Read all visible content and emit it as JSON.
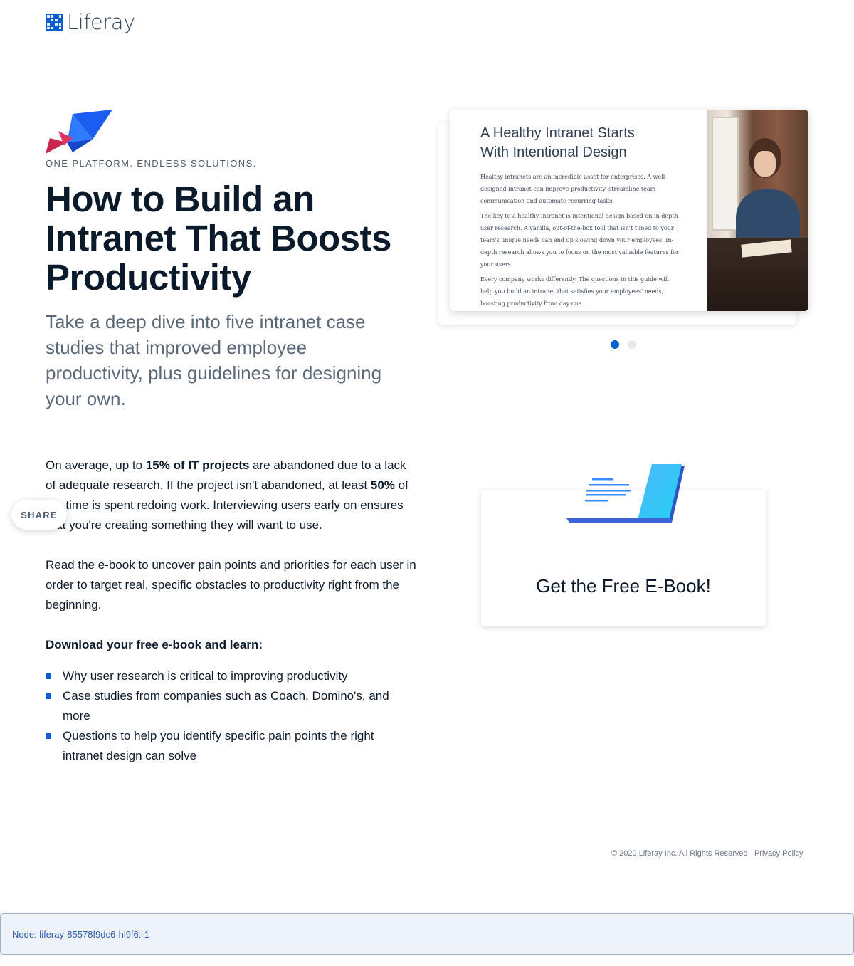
{
  "header": {
    "logo_text": "Liferay"
  },
  "hero": {
    "eyebrow": "ONE PLATFORM. ENDLESS SOLUTIONS.",
    "title": "How to Build an Intranet That Boosts Productivity",
    "subtitle": "Take a deep dive into five intranet case studies that improved employee productivity, plus guidelines for designing your own."
  },
  "preview": {
    "title_line1": "A Healthy Intranet Starts",
    "title_line2": "With Intentional Design",
    "para1": "Healthy intranets are an incredible asset for enterprises. A well-designed intranet can improve productivity, streamline team communication and automate recurring tasks.",
    "para2": "The key to a healthy intranet is intentional design based on in-depth user research. A vanilla, out-of-the-box tool that isn't tuned to your team's unique needs can end up slowing down your employees. In-depth research allows you to focus on the most valuable features for your users.",
    "para3": "Every company works differently. The questions in this guide will help you build an intranet that satisfies your employees' needs, boosting productivity from day one.",
    "active_slide": 1,
    "slide_count": 2
  },
  "body": {
    "p1_a": "On average, up to ",
    "p1_b": "15% of IT projects",
    "p1_c": " are abandoned due to a lack of adequate research. If the project isn't abandoned, at least ",
    "p1_d": "50%",
    "p1_e": " of the time is spent redoing work. Interviewing users early on ensures that you're creating something they will want to use.",
    "p2": "Read the e-book to uncover pain points and priorities for each user in order to target real, specific obstacles to productivity right from the beginning.",
    "learn_heading": "Download your free e-book and learn:",
    "bullets": [
      "Why user research is critical to improving productivity",
      "Case studies from companies such as Coach, Domino's, and more",
      "Questions to help you identify specific pain points the right intranet design can solve"
    ]
  },
  "share": {
    "label": "SHARE"
  },
  "cta": {
    "label": "Get the Free E-Book!"
  },
  "footer": {
    "copyright": "© 2020 Liferay Inc. All Rights Reserved",
    "privacy": "Privacy Policy"
  },
  "node_bar": {
    "text": "Node: liferay-85578f9dc6-hl9f6:-1"
  },
  "colors": {
    "accent": "#0b5fcc",
    "text": "#0b1a2b",
    "muted": "#5b6878"
  }
}
